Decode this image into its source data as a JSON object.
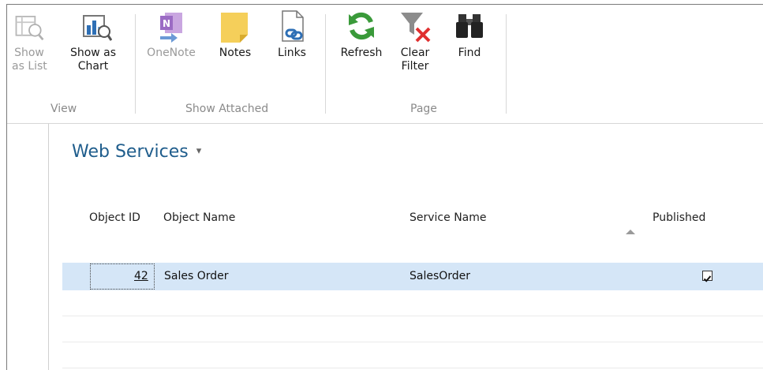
{
  "ribbon": {
    "groups": [
      {
        "label": "View",
        "buttons": [
          {
            "label_line1": "Show",
            "label_line2": "as List",
            "icon": "list-view-icon",
            "disabled": true
          },
          {
            "label_line1": "Show as",
            "label_line2": "Chart",
            "icon": "chart-view-icon",
            "disabled": false
          }
        ]
      },
      {
        "label": "Show Attached",
        "buttons": [
          {
            "label_line1": "OneNote",
            "label_line2": "",
            "icon": "onenote-icon",
            "disabled": true
          },
          {
            "label_line1": "Notes",
            "label_line2": "",
            "icon": "notes-icon",
            "disabled": false
          },
          {
            "label_line1": "Links",
            "label_line2": "",
            "icon": "links-icon",
            "disabled": false
          }
        ]
      },
      {
        "label": "Page",
        "buttons": [
          {
            "label_line1": "Refresh",
            "label_line2": "",
            "icon": "refresh-icon",
            "disabled": false
          },
          {
            "label_line1": "Clear",
            "label_line2": "Filter",
            "icon": "clear-filter-icon",
            "disabled": false
          },
          {
            "label_line1": "Find",
            "label_line2": "",
            "icon": "binoculars-icon",
            "disabled": false
          }
        ]
      }
    ]
  },
  "page": {
    "title": "Web Services",
    "title_caret": "▾"
  },
  "table": {
    "columns": [
      "Object ID",
      "Object Name",
      "Service Name",
      "Published"
    ],
    "sorted_column": "Published",
    "rows": [
      {
        "object_id": "42",
        "object_name": "Sales Order",
        "service_name": "SalesOrder",
        "published": true,
        "selected": true
      }
    ]
  },
  "colors": {
    "selected_row": "#d5e6f7",
    "title": "#1f5d8c",
    "refresh_green": "#3a9a3a",
    "clear_filter_red": "#e03030",
    "notes_yellow": "#f5cf5a",
    "onenote_purple": "#8a4fb0"
  }
}
